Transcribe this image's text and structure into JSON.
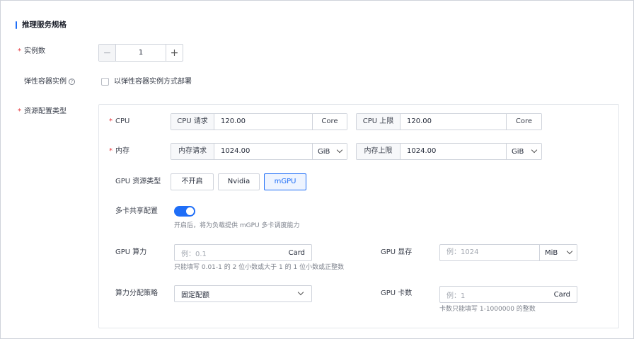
{
  "section": {
    "title": "推理服务规格"
  },
  "instance_count": {
    "label": "实例数",
    "required_mark": "*",
    "value": "1",
    "minus": "−",
    "plus": "+"
  },
  "elastic": {
    "label": "弹性容器实例",
    "help": "?",
    "checkbox_label": "以弹性容器实例方式部署",
    "checked": false
  },
  "resource": {
    "label": "资源配置类型",
    "required_mark": "*",
    "cpu": {
      "label": "CPU",
      "request_addon": "CPU 请求",
      "request_value": "120.00",
      "request_unit": "Core",
      "limit_addon": "CPU 上限",
      "limit_value": "120.00",
      "limit_unit": "Core"
    },
    "memory": {
      "label": "内存",
      "request_addon": "内存请求",
      "request_value": "1024.00",
      "request_unit": "GiB",
      "limit_addon": "内存上限",
      "limit_value": "1024.00",
      "limit_unit": "GiB"
    },
    "gpu_type": {
      "label": "GPU 资源类型",
      "options": [
        "不开启",
        "Nvidia",
        "mGPU"
      ],
      "selected": "mGPU"
    },
    "multi_card": {
      "label": "多卡共享配置",
      "enabled": true,
      "hint": "开启后，将为负载提供 mGPU 多卡调度能力"
    },
    "gpu_compute": {
      "label": "GPU 算力",
      "placeholder": "例：0.1",
      "suffix": "Card",
      "hint": "只能填写 0.01-1 的 2 位小数或大于 1 的 1 位小数或正整数"
    },
    "gpu_memory": {
      "label": "GPU 显存",
      "placeholder": "例：1024",
      "unit": "MiB"
    },
    "strategy": {
      "label": "算力分配策略",
      "value": "固定配额"
    },
    "gpu_cards": {
      "label": "GPU 卡数",
      "placeholder": "例：1",
      "suffix": "Card",
      "hint": "卡数只能填写 1-1000000 的整数"
    }
  }
}
